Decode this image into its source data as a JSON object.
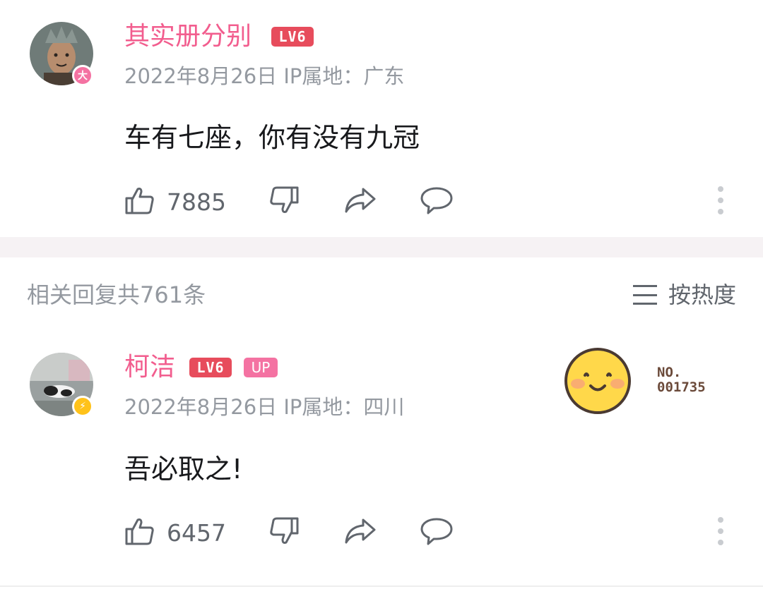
{
  "comments": [
    {
      "username": "其实册分别",
      "level": "LV6",
      "badge": "大",
      "date": "2022年8月26日",
      "ip_label": "IP属地：",
      "ip_location": "广东",
      "content": "车有七座，你有没有九冠",
      "likes": "7885"
    },
    {
      "username": "柯洁",
      "level": "LV6",
      "up_tag": "UP",
      "badge": "⚡",
      "date": "2022年8月26日",
      "ip_label": "IP属地：",
      "ip_location": "四川",
      "content": "吾必取之!",
      "likes": "6457",
      "sticker_no_label": "NO.",
      "sticker_no_value": "001735"
    }
  ],
  "replies_section": {
    "title": "相关回复共761条",
    "sort_label": "按热度"
  },
  "icons": {
    "like": "thumbs-up-icon",
    "dislike": "thumbs-down-icon",
    "share": "share-icon",
    "reply": "comment-icon",
    "more": "more-vertical-icon",
    "sort": "menu-lines-icon"
  },
  "colors": {
    "username": "#f25d8e",
    "level_badge": "#e74c5c",
    "up_tag": "#f472a2",
    "meta": "#9499a0",
    "badge_pink": "#f472a2",
    "badge_yellow": "#ffc21a"
  }
}
